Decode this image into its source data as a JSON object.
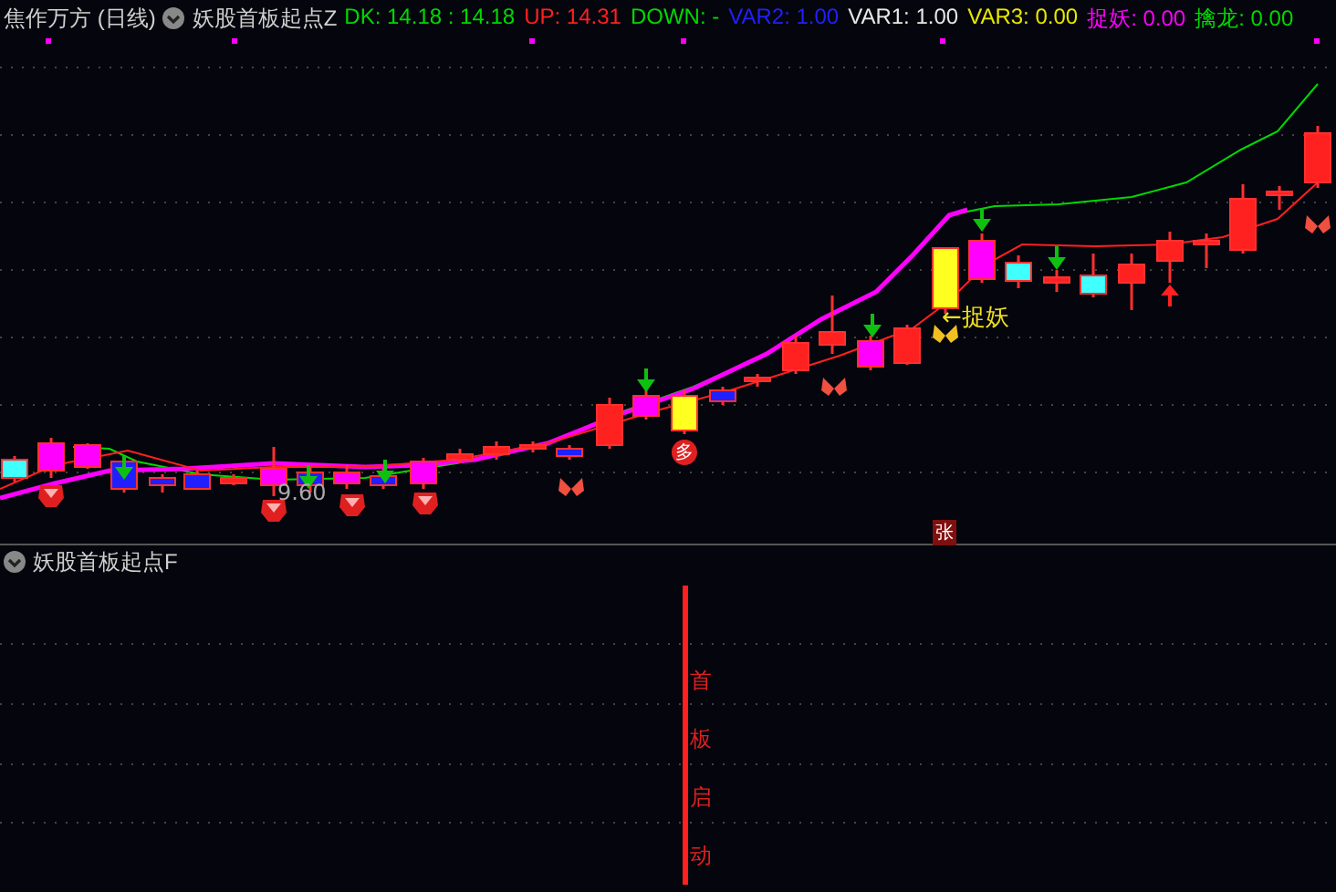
{
  "main_panel": {
    "symbol": "焦作万方 (日线)",
    "indicator": "妖股首板起点Z",
    "values": [
      {
        "label": "DK:",
        "value": "14.18 : 14.18",
        "color": "#00d800"
      },
      {
        "label": "UP:",
        "value": "14.31",
        "color": "#ff2020"
      },
      {
        "label": "DOWN:",
        "value": "-",
        "color": "#00d800"
      },
      {
        "label": "VAR2:",
        "value": "1.00",
        "color": "#2020ff"
      },
      {
        "label": "VAR1:",
        "value": "1.00",
        "color": "#e8e8e8"
      },
      {
        "label": "VAR3:",
        "value": "0.00",
        "color": "#e8e800"
      },
      {
        "label": "捉妖:",
        "value": "0.00",
        "color": "#ff00ff"
      },
      {
        "label": "擒龙:",
        "value": "0.00",
        "color": "#00d800"
      }
    ],
    "price_label": "9.60",
    "signal_label": "←捉妖",
    "buy_badge": "多",
    "rise_badge": "张"
  },
  "sub_panel": {
    "indicator": "妖股首板起点F",
    "signal_text": "首板启动"
  }
}
